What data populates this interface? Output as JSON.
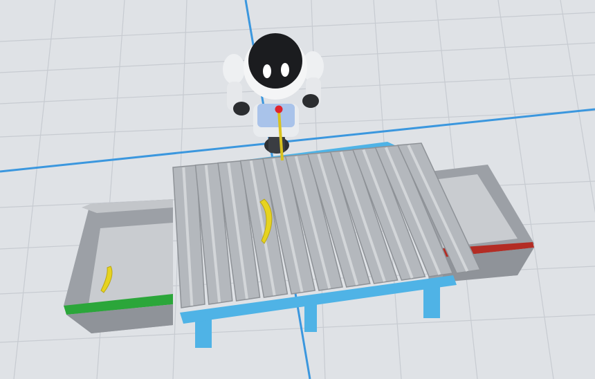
{
  "scene": {
    "floor_color": "#dfe2e6",
    "grid_minor_color": "#c7cbd1",
    "grid_major_color": "#3b97de",
    "conveyor_frame_color": "#4fb3e6",
    "roller_color": "#b4b8bd",
    "bin_color": "#a9adb3",
    "bin_left_stripe_color": "#2ba63a",
    "bin_right_stripe_color": "#b32c24",
    "banana_color": "#e6d31f",
    "objects": {
      "robot": "robot-character",
      "pointer": "grab-pointer",
      "conveyor": "roller-conveyor",
      "bin_left": "sorting-bin-green",
      "bin_right": "sorting-bin-red",
      "banana_on_conveyor": "banana",
      "banana_in_bin": "banana"
    }
  }
}
